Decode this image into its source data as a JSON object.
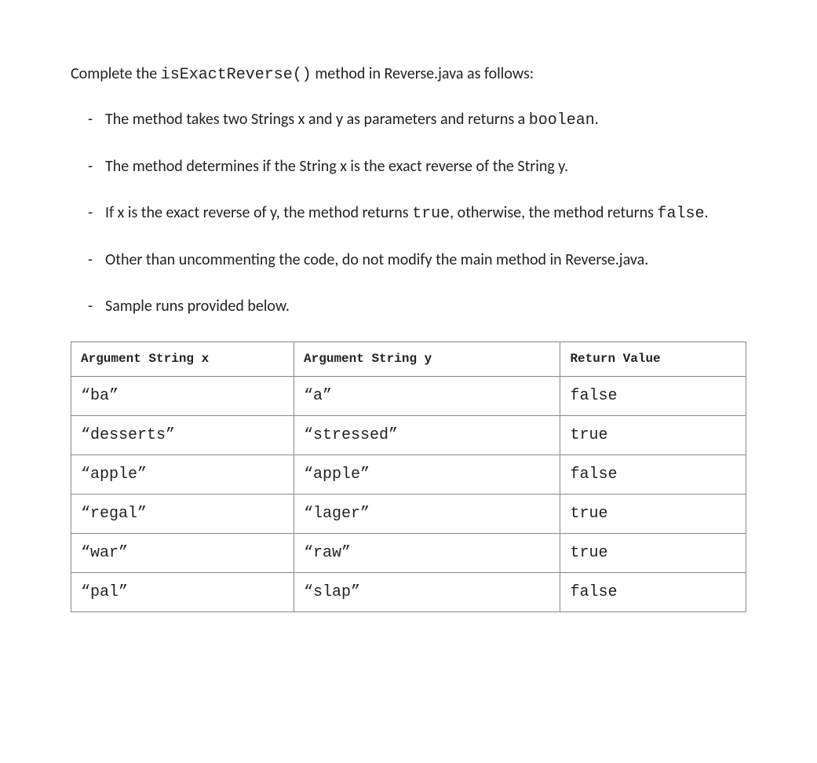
{
  "intro": {
    "pre": "Complete the ",
    "code": "isExactReverse()",
    "post": " method in Reverse.java as follows:"
  },
  "bullets": [
    {
      "runs": [
        {
          "t": "The method takes two Strings x and y as parameters and returns a ",
          "m": false
        },
        {
          "t": "boolean",
          "m": true
        },
        {
          "t": ".",
          "m": false
        }
      ]
    },
    {
      "runs": [
        {
          "t": "The method determines if the String x is the exact reverse of the String y.",
          "m": false
        }
      ]
    },
    {
      "runs": [
        {
          "t": "If x is the exact reverse of y, the method returns ",
          "m": false
        },
        {
          "t": "true",
          "m": true
        },
        {
          "t": ", otherwise, the method returns ",
          "m": false
        },
        {
          "t": "false",
          "m": true
        },
        {
          "t": ".",
          "m": false
        }
      ]
    },
    {
      "runs": [
        {
          "t": "Other than uncommenting the code, do not modify the main method in Reverse.java.",
          "m": false
        }
      ]
    },
    {
      "runs": [
        {
          "t": "Sample runs provided below.",
          "m": false
        }
      ]
    }
  ],
  "table": {
    "headers": [
      "Argument String x",
      "Argument String y",
      "Return Value"
    ],
    "rows": [
      [
        "“ba”",
        "“a”",
        "false"
      ],
      [
        "“desserts”",
        "“stressed”",
        "true"
      ],
      [
        "“apple”",
        "“apple”",
        "false"
      ],
      [
        "“regal”",
        "“lager”",
        "true"
      ],
      [
        "“war”",
        "“raw”",
        "true"
      ],
      [
        "“pal”",
        "“slap”",
        "false"
      ]
    ]
  }
}
